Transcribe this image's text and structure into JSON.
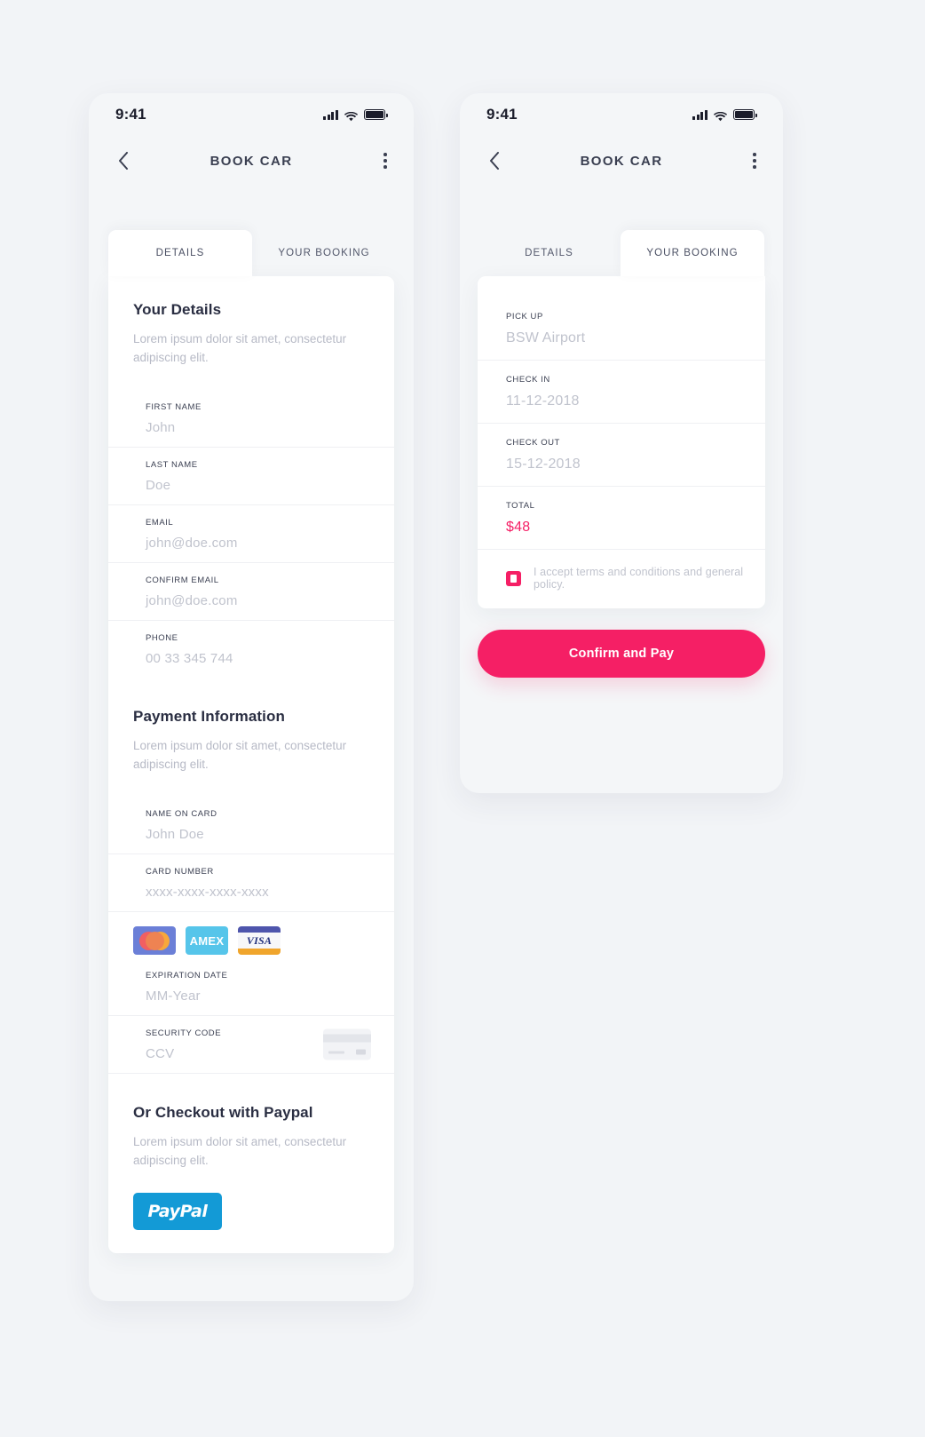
{
  "statusbar": {
    "time": "9:41",
    "icons": [
      "signal-bars-icon",
      "wifi-icon",
      "battery-icon"
    ]
  },
  "navbar": {
    "title": "BOOK CAR",
    "back_icon": "chevron-left-icon",
    "more_icon": "more-vertical-icon"
  },
  "tabs": {
    "details": "DETAILS",
    "booking": "YOUR BOOKING",
    "left_active": "DETAILS",
    "right_active": "YOUR BOOKING"
  },
  "details_screen": {
    "your_details": {
      "title": "Your Details",
      "subtitle": "Lorem ipsum dolor sit amet, consectetur adipiscing elit.",
      "fields": [
        {
          "label": "FIRST NAME",
          "value": "John"
        },
        {
          "label": "LAST NAME",
          "value": "Doe"
        },
        {
          "label": "EMAIL",
          "value": "john@doe.com"
        },
        {
          "label": "CONFIRM EMAIL",
          "value": "john@doe.com"
        },
        {
          "label": "PHONE",
          "value": "00 33 345 744"
        }
      ]
    },
    "payment_information": {
      "title": "Payment Information",
      "subtitle": "Lorem ipsum dolor sit amet, consectetur adipiscing elit.",
      "fields": [
        {
          "label": "NAME ON CARD",
          "value": "John Doe"
        },
        {
          "label": "CARD NUMBER",
          "value": "xxxx-xxxx-xxxx-xxxx"
        },
        {
          "label": "EXPIRATION DATE",
          "value": "MM-Year"
        },
        {
          "label": "SECURITY CODE",
          "value": "CCV"
        }
      ],
      "brands": [
        {
          "name": "mastercard-icon",
          "label": ""
        },
        {
          "name": "amex-icon",
          "label": "AMEX"
        },
        {
          "name": "visa-icon",
          "label": "VISA"
        }
      ],
      "ccv_hint_icon": "credit-card-back-icon"
    },
    "paypal": {
      "title": "Or Checkout with Paypal",
      "subtitle": "Lorem ipsum dolor sit amet, consectetur adipiscing elit.",
      "button_label": "PayPal"
    }
  },
  "booking_screen": {
    "fields": [
      {
        "label": "PICK UP",
        "value": "BSW Airport"
      },
      {
        "label": "CHECK IN",
        "value": "11-12-2018"
      },
      {
        "label": "CHECK OUT",
        "value": "15-12-2018"
      },
      {
        "label": "TOTAL",
        "value": "$48"
      }
    ],
    "terms_text": "I accept terms and conditions and general policy.",
    "terms_checked": true,
    "confirm_label": "Confirm and Pay"
  },
  "colors": {
    "accent_pink": "#f51f65",
    "paypal_blue": "#139ad6",
    "amex_blue": "#56c5ea",
    "mastercard_bg": "#6b7fd7",
    "visa_navy": "#4e55ac",
    "visa_gold": "#f0a52c",
    "page_bg": "#f2f4f7",
    "card_bg": "#ffffff",
    "text_dark": "#2a2e42",
    "text_muted": "#c0c3cd"
  }
}
